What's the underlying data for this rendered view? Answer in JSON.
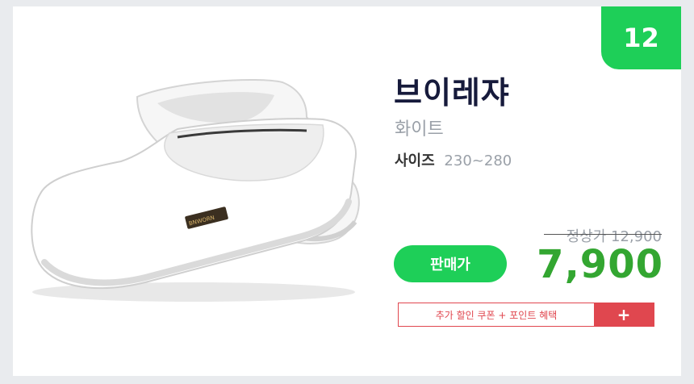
{
  "rank": "12",
  "product": {
    "name": "브이레쟈",
    "color": "화이트",
    "size_label": "사이즈",
    "size_value": "230~280",
    "tag_text": "BNWORN"
  },
  "pricing": {
    "sale_button_label": "판매가",
    "regular_price": "정상가 12,900",
    "sale_price": "7,900"
  },
  "coupon": {
    "text": "추가 할인 쿠폰 + 포인트 혜택",
    "plus_label": "+"
  },
  "colors": {
    "accent_green": "#1ecf58",
    "price_green": "#33a631",
    "coupon_red": "#e0474f",
    "title_navy": "#161a3b"
  }
}
